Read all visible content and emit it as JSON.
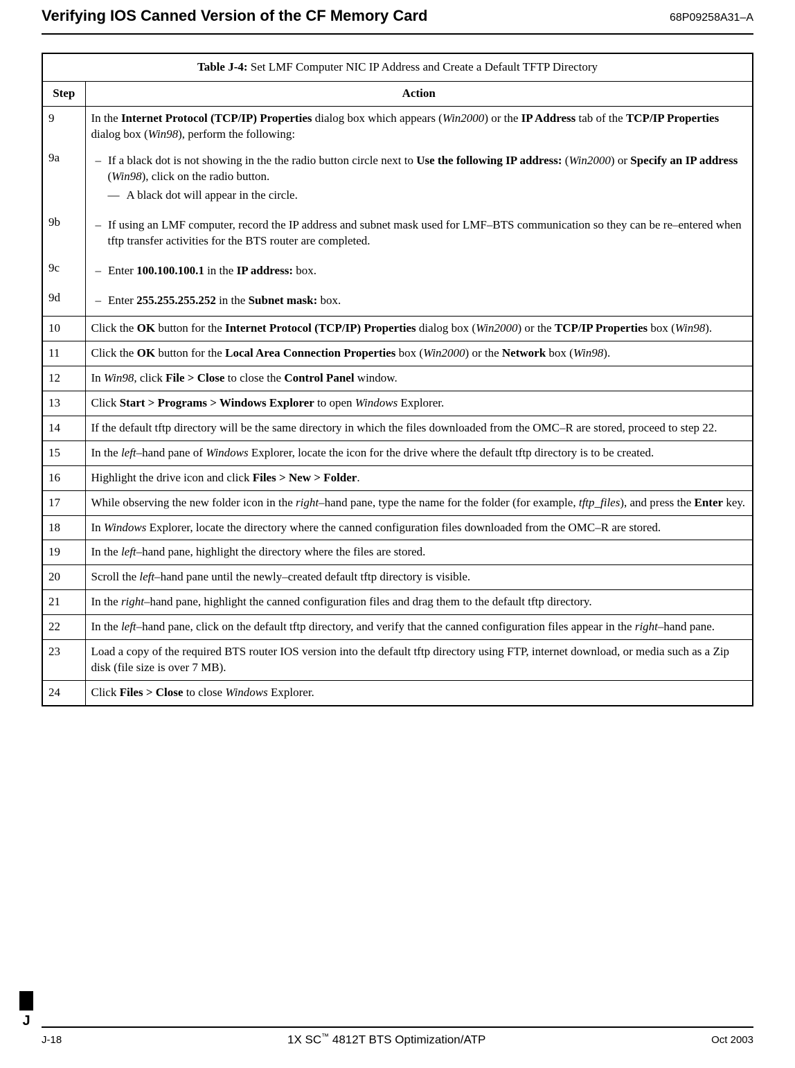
{
  "header": {
    "title": "Verifying IOS Canned Version of the CF Memory Card",
    "doc_number": "68P09258A31–A"
  },
  "table": {
    "caption_label": "Table J-4:",
    "caption_text": " Set LMF Computer NIC IP Address and Create a Default TFTP Directory",
    "col_step": "Step",
    "col_action": "Action",
    "row9": {
      "step": "9",
      "text_pre": "In the ",
      "text_b1": "Internet Protocol (TCP/IP) Properties",
      "text_mid1": " dialog box which appears (",
      "text_i1": "Win2000",
      "text_mid2": ") or the ",
      "text_b2": "IP Address",
      "text_mid3": " tab of the ",
      "text_b3": "TCP/IP Properties",
      "text_mid4": " dialog box (",
      "text_i2": "Win98",
      "text_end": "), perform the following:"
    },
    "row9a": {
      "step": "9a",
      "text_pre": "If a black dot is not showing in the the radio button circle next to ",
      "text_b1": "Use the following IP address:",
      "text_mid1": " (",
      "text_i1": "Win2000",
      "text_mid2": ") or ",
      "text_b2": "Specify an IP address",
      "text_mid3": " (",
      "text_i2": "Win98",
      "text_end": "), click on the radio button.",
      "sub": "A black dot will appear in the circle."
    },
    "row9b": {
      "step": "9b",
      "text": "If using an LMF computer, record the IP address and subnet mask used for LMF–BTS communication so they can be re–entered when tftp transfer activities for the BTS router are completed."
    },
    "row9c": {
      "step": "9c",
      "pre": "Enter ",
      "b1": "100.100.100.1",
      "mid": " in the ",
      "b2": "IP address:",
      "end": " box."
    },
    "row9d": {
      "step": "9d",
      "pre": "Enter ",
      "b1": "255.255.255.252",
      "mid": " in the ",
      "b2": "Subnet mask:",
      "end": " box."
    },
    "row10": {
      "step": "10",
      "pre": "Click the ",
      "b1": "OK",
      "mid1": " button for the ",
      "b2": "Internet Protocol (TCP/IP) Properties",
      "mid2": " dialog box (",
      "i1": "Win2000",
      "mid3": ") or the ",
      "b3": "TCP/IP Properties",
      "mid4": " box (",
      "i2": "Win98",
      "end": ")."
    },
    "row11": {
      "step": "11",
      "pre": "Click the ",
      "b1": "OK",
      "mid1": " button for the ",
      "b2": "Local Area Connection Properties",
      "mid2": " box (",
      "i1": "Win2000",
      "mid3": ") or the ",
      "b3": "Network",
      "mid4": " box (",
      "i2": "Win98",
      "end": ")."
    },
    "row12": {
      "step": "12",
      "pre": "In ",
      "i1": "Win98",
      "mid1": ", click ",
      "b1": "File > Close",
      "mid2": " to close the ",
      "b2": "Control Panel",
      "end": " window."
    },
    "row13": {
      "step": "13",
      "pre": "Click ",
      "b1": "Start > Programs > Windows Explorer",
      "mid": " to open ",
      "i1": "Windows",
      "end": " Explorer."
    },
    "row14": {
      "step": "14",
      "text": "If the default tftp directory will be the same directory in which the files downloaded from the OMC–R are stored, proceed to step 22."
    },
    "row15": {
      "step": "15",
      "pre": "In the ",
      "i1": "left",
      "mid1": "–hand pane of ",
      "i2": "Windows",
      "end": " Explorer, locate the icon for the drive where the default tftp directory is to be created."
    },
    "row16": {
      "step": "16",
      "pre": "Highlight the drive icon and click ",
      "b1": "Files > New > Folder",
      "end": "."
    },
    "row17": {
      "step": "17",
      "pre": "While observing the new folder icon in the ",
      "i1": "right",
      "mid1": "–hand pane, type the name for the folder (for example, ",
      "i2": "tftp_files",
      "mid2": "), and press the ",
      "b1": "Enter",
      "end": " key."
    },
    "row18": {
      "step": "18",
      "pre": "In ",
      "i1": "Windows",
      "end": " Explorer, locate the directory where the canned configuration files downloaded from the OMC–R are stored."
    },
    "row19": {
      "step": "19",
      "pre": "In the ",
      "i1": "left",
      "end": "–hand pane, highlight the directory where the files are stored."
    },
    "row20": {
      "step": "20",
      "pre": "Scroll the  ",
      "i1": "left",
      "end": "–hand pane until the newly–created default tftp directory is visible."
    },
    "row21": {
      "step": "21",
      "pre": "In the ",
      "i1": "right",
      "end": "–hand pane, highlight the canned configuration files and drag them to the default tftp directory."
    },
    "row22": {
      "step": "22",
      "pre": "In the ",
      "i1": "left",
      "mid": "–hand pane, click on the default tftp directory, and verify that the canned configuration files appear in the ",
      "i2": "right",
      "end": "–hand pane."
    },
    "row23": {
      "step": "23",
      "text": "Load a copy of the required BTS router IOS version into the default tftp directory using FTP, internet download, or media such as a Zip disk (file size is over 7 MB)."
    },
    "row24": {
      "step": "24",
      "pre": "Click ",
      "b1": "Files > Close",
      "mid": " to close ",
      "i1": "Windows",
      "end": " Explorer."
    }
  },
  "tab_letter": "J",
  "footer": {
    "left": "J-18",
    "center_pre": "1X SC",
    "center_tm": "™",
    "center_post": " 4812T BTS Optimization/ATP",
    "right": "Oct 2003"
  }
}
